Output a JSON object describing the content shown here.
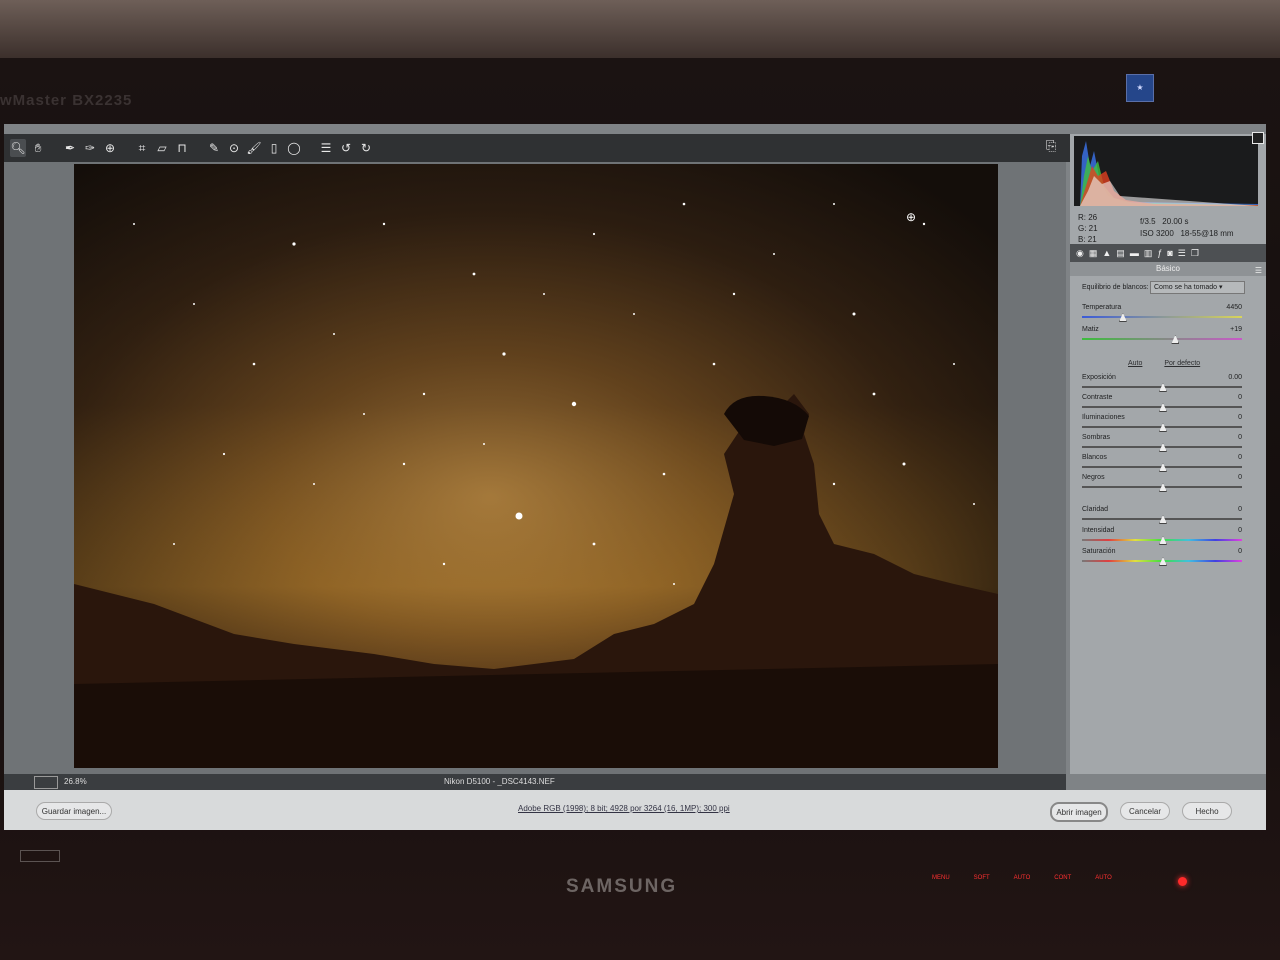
{
  "monitor": {
    "model_label": "wMaster BX2235",
    "brand": "SAMSUNG",
    "buttons": [
      "MENU",
      "SOFT",
      "AUTO",
      "CONT",
      "AUTO"
    ]
  },
  "toolbar": {
    "tools": [
      "zoom-icon",
      "hand-icon",
      "white-balance-icon",
      "color-sampler-icon",
      "target-adjust-icon",
      "crop-icon",
      "straighten-icon",
      "transform-icon",
      "spot-removal-icon",
      "red-eye-icon",
      "adjustment-brush-icon",
      "graduated-filter-icon",
      "radial-filter-icon",
      "preferences-icon",
      "rotate-left-icon",
      "rotate-right-icon"
    ]
  },
  "histogram": {
    "rgb": {
      "r": "R:   26",
      "g": "G:   21",
      "b": "B:   21"
    },
    "exif": {
      "aperture": "f/3.5",
      "shutter": "20.00 s",
      "iso": "ISO 3200",
      "lens": "18-55@18 mm"
    }
  },
  "panel": {
    "section_title": "Básico",
    "wb_label": "Equilibrio de blancos:",
    "wb_value": "Como se ha tomado",
    "temperature": {
      "label": "Temperatura",
      "value": "4450",
      "pos": 0.24
    },
    "tint": {
      "label": "Matiz",
      "value": "+19",
      "pos": 0.58
    },
    "auto": "Auto",
    "default": "Por defecto",
    "sliders": [
      {
        "label": "Exposición",
        "value": "0.00",
        "pos": 0.5
      },
      {
        "label": "Contraste",
        "value": "0",
        "pos": 0.5
      },
      {
        "label": "Iluminaciones",
        "value": "0",
        "pos": 0.5
      },
      {
        "label": "Sombras",
        "value": "0",
        "pos": 0.5
      },
      {
        "label": "Blancos",
        "value": "0",
        "pos": 0.5
      },
      {
        "label": "Negros",
        "value": "0",
        "pos": 0.5
      }
    ],
    "presence": [
      {
        "label": "Claridad",
        "value": "0",
        "pos": 0.5
      },
      {
        "label": "Intensidad",
        "value": "0",
        "pos": 0.5
      },
      {
        "label": "Saturación",
        "value": "0",
        "pos": 0.5
      }
    ]
  },
  "status": {
    "zoom": "26.8%",
    "file": "Nikon D5100 - _DSC4143.NEF"
  },
  "bottom": {
    "save": "Guardar imagen...",
    "workflow": "Adobe RGB (1998); 8 bit; 4928 por 3264 (16, 1MP); 300 ppi",
    "open": "Abrir imagen",
    "cancel": "Cancelar",
    "done": "Hecho"
  }
}
